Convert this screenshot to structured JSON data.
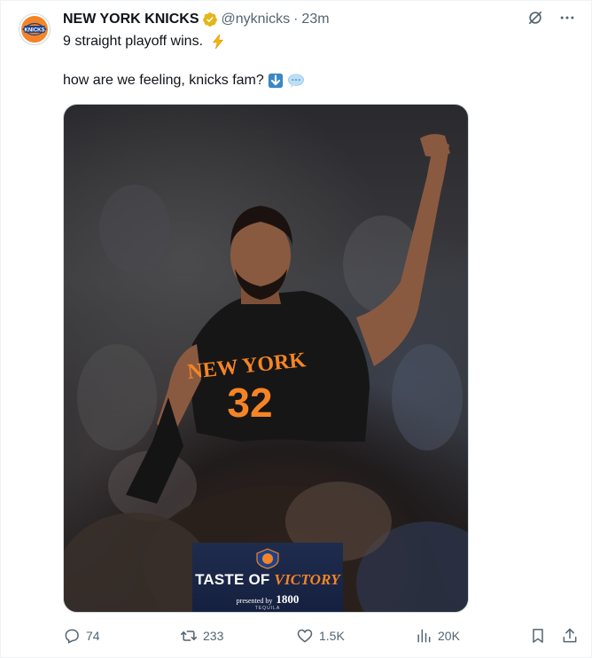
{
  "account": {
    "name": "NEW YORK KNICKS",
    "handle": "@nyknicks",
    "separator": "·",
    "time": "23m",
    "verified": true,
    "avatar_icon": "knicks-logo-icon"
  },
  "tweet": {
    "line1": "9 straight playoff wins.",
    "line1_emoji": "high-voltage-emoji",
    "line2": "how are we feeling, knicks fam?",
    "line2_emojis": [
      "down-arrow-emoji",
      "speech-balloon-emoji"
    ]
  },
  "media": {
    "jersey_text": "NEW YORK",
    "jersey_number": "32",
    "banner": {
      "line1_a": "TASTE OF ",
      "line1_b": "VICTORY",
      "presented_by": "presented by",
      "sponsor": "1800",
      "sponsor_sub": "TEQUILA"
    }
  },
  "actions": {
    "replies": "74",
    "reposts": "233",
    "likes": "1.5K",
    "views": "20K"
  },
  "colors": {
    "knicks_orange": "#F58426",
    "knicks_blue": "#006BB6",
    "verified_gold": "#E2B719",
    "secondary_text": "#536471"
  }
}
